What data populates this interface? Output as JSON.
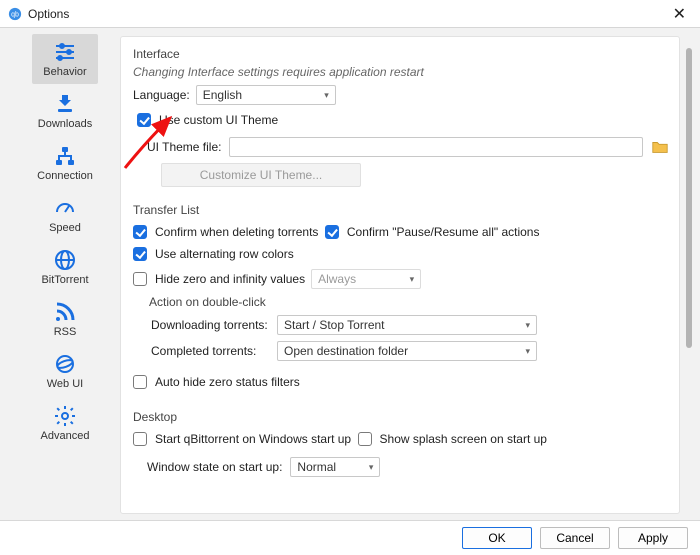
{
  "window": {
    "title": "Options"
  },
  "sidebar": {
    "items": [
      {
        "label": "Behavior"
      },
      {
        "label": "Downloads"
      },
      {
        "label": "Connection"
      },
      {
        "label": "Speed"
      },
      {
        "label": "BitTorrent"
      },
      {
        "label": "RSS"
      },
      {
        "label": "Web UI"
      },
      {
        "label": "Advanced"
      }
    ]
  },
  "interface": {
    "title": "Interface",
    "note": "Changing Interface settings requires application restart",
    "language_label": "Language:",
    "language_value": "English",
    "use_custom_theme": "Use custom UI Theme",
    "theme_file_label": "UI Theme file:",
    "theme_file_value": "",
    "customize_btn": "Customize UI Theme..."
  },
  "transfer": {
    "title": "Transfer List",
    "confirm_delete": "Confirm when deleting torrents",
    "confirm_pause": "Confirm \"Pause/Resume all\" actions",
    "alt_rows": "Use alternating row colors",
    "hide_zero": "Hide zero and infinity values",
    "hide_zero_mode": "Always",
    "dbl_title": "Action on double-click",
    "dbl_down_label": "Downloading torrents:",
    "dbl_down_value": "Start / Stop Torrent",
    "dbl_comp_label": "Completed torrents:",
    "dbl_comp_value": "Open destination folder",
    "auto_hide": "Auto hide zero status filters"
  },
  "desktop": {
    "title": "Desktop",
    "start_on_boot": "Start qBittorrent on Windows start up",
    "splash": "Show splash screen on start up",
    "win_state_label": "Window state on start up:",
    "win_state_value": "Normal"
  },
  "footer": {
    "ok": "OK",
    "cancel": "Cancel",
    "apply": "Apply"
  }
}
